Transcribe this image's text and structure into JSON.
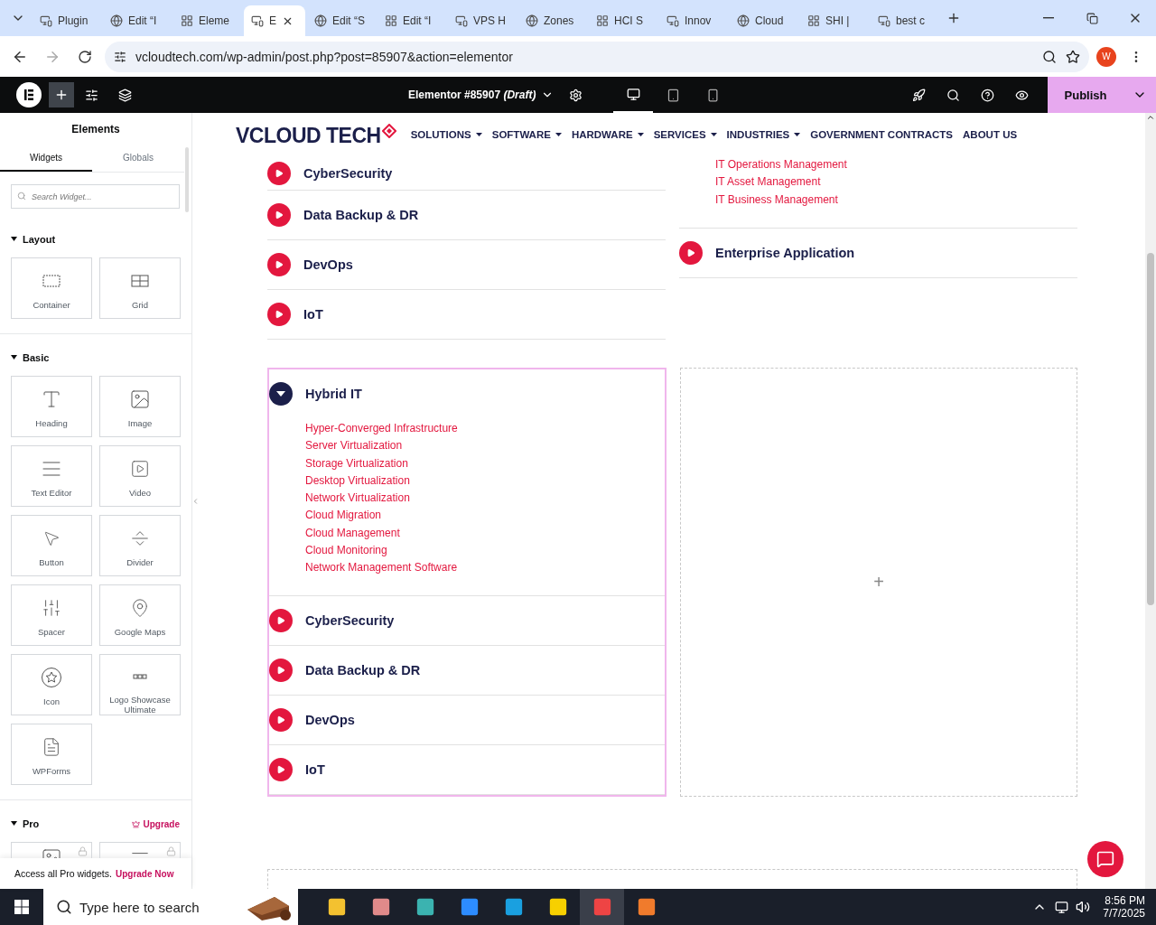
{
  "browser": {
    "tabs": [
      {
        "title": "Plugin",
        "selected": false
      },
      {
        "title": "Edit “I",
        "selected": false
      },
      {
        "title": "Eleme",
        "selected": false
      },
      {
        "title": "E",
        "selected": true
      },
      {
        "title": "Edit “S",
        "selected": false
      },
      {
        "title": "Edit “I",
        "selected": false
      },
      {
        "title": "VPS H",
        "selected": false
      },
      {
        "title": "Zones",
        "selected": false
      },
      {
        "title": "HCI S",
        "selected": false
      },
      {
        "title": "Innov",
        "selected": false
      },
      {
        "title": "Cloud",
        "selected": false
      },
      {
        "title": "SHI |",
        "selected": false
      },
      {
        "title": "best c",
        "selected": false
      }
    ],
    "url": "vcloudtech.com/wp-admin/post.php?post=85907&action=elementor",
    "profile": "W"
  },
  "editor_bar": {
    "title": "Elementor #85907 *(Draft)*",
    "publish": "Publish"
  },
  "panel": {
    "title": "Elements",
    "tabs": [
      {
        "label": "Widgets",
        "selected": true
      },
      {
        "label": "Globals",
        "selected": false
      }
    ],
    "search": {
      "placeholder": "Search Widget..."
    },
    "sections": [
      {
        "title": "Layout",
        "expanded": true,
        "widgets": [
          "Container",
          "Grid"
        ]
      },
      {
        "title": "Basic",
        "expanded": true,
        "widgets": [
          "Heading",
          "Image",
          "Text Editor",
          "Video",
          "Button",
          "Divider",
          "Spacer",
          "Google Maps",
          "Icon",
          "Logo Showcase Ultimate",
          "WPForms"
        ]
      }
    ],
    "pro": {
      "title": "Pro",
      "expanded": true,
      "upgrade": "Upgrade"
    },
    "promo": {
      "text": "Access all Pro widgets.",
      "link": "Upgrade Now"
    }
  },
  "site": {
    "logo": "VCLOUD TECH",
    "nav": [
      {
        "label": "SOLUTIONS",
        "dropdown": true
      },
      {
        "label": "SOFTWARE",
        "dropdown": true
      },
      {
        "label": "HARDWARE",
        "dropdown": true
      },
      {
        "label": "SERVICES",
        "dropdown": true
      },
      {
        "label": "INDUSTRIES",
        "dropdown": true
      },
      {
        "label": "GOVERNMENT CONTRACTS",
        "dropdown": false
      },
      {
        "label": "ABOUT US",
        "dropdown": false
      }
    ]
  },
  "top_accordion": {
    "items": [
      {
        "title": "CyberSecurity",
        "expanded": false
      },
      {
        "title": "Data Backup & DR",
        "expanded": false
      },
      {
        "title": "DevOps",
        "expanded": false
      },
      {
        "title": "IoT",
        "expanded": false
      }
    ]
  },
  "right_accordion": {
    "links": [
      "IT Operations Management",
      "IT Asset Management",
      "IT Business Management"
    ],
    "items": [
      {
        "title": "Enterprise Application",
        "expanded": false
      }
    ]
  },
  "main_accordion": {
    "items": [
      {
        "title": "Hybrid IT",
        "expanded": true,
        "links": [
          "Hyper-Converged Infrastructure",
          "Server Virtualization",
          "Storage Virtualization",
          "Desktop Virtualization",
          "Network Virtualization",
          "Cloud Migration",
          "Cloud Management",
          "Cloud Monitoring",
          "Network Management Software"
        ]
      },
      {
        "title": "CyberSecurity",
        "expanded": false
      },
      {
        "title": "Data Backup & DR",
        "expanded": false
      },
      {
        "title": "DevOps",
        "expanded": false
      },
      {
        "title": "IoT",
        "expanded": false
      }
    ]
  },
  "empty_column": {
    "add": "+"
  },
  "taskbar": {
    "search": {
      "placeholder": "Type here to search"
    },
    "time": "8:56 PM",
    "date": "7/7/2025"
  }
}
